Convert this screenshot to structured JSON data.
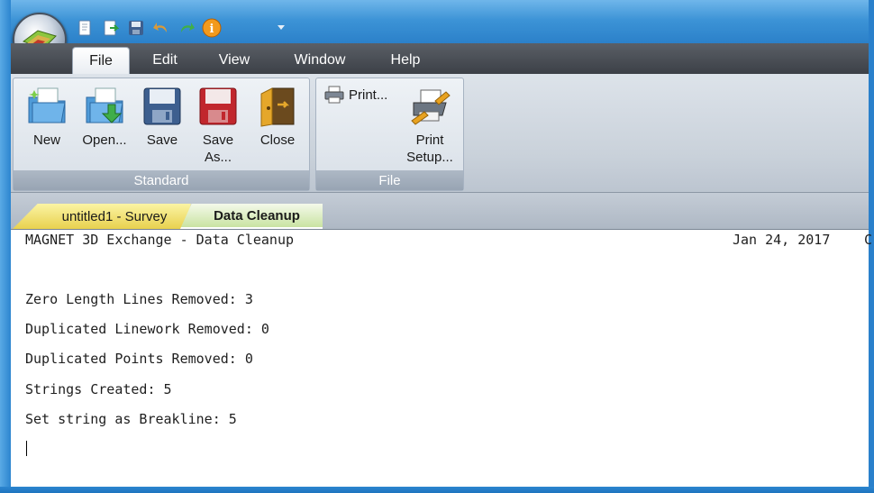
{
  "quick_access": {
    "icons": [
      "new-doc-icon",
      "open-doc-icon",
      "save-icon",
      "undo-icon",
      "redo-icon",
      "info-icon"
    ]
  },
  "menu": {
    "tabs": [
      {
        "label": "File",
        "active": true
      },
      {
        "label": "Edit",
        "active": false
      },
      {
        "label": "View",
        "active": false
      },
      {
        "label": "Window",
        "active": false
      },
      {
        "label": "Help",
        "active": false
      }
    ]
  },
  "ribbon": {
    "groups": {
      "standard": {
        "label": "Standard",
        "buttons": {
          "new": "New",
          "open": "Open...",
          "save": "Save",
          "save_as_line1": "Save",
          "save_as_line2": "As...",
          "close": "Close"
        }
      },
      "file": {
        "label": "File",
        "print": "Print...",
        "print_setup_line1": "Print",
        "print_setup_line2": "Setup..."
      }
    }
  },
  "document_tabs": [
    {
      "label": "untitled1 - Survey",
      "active": false
    },
    {
      "label": "Data Cleanup",
      "active": true
    }
  ],
  "report": {
    "title": "MAGNET 3D Exchange - Data Cleanup",
    "date": "Jan 24, 2017",
    "date_overflow": "C",
    "lines": [
      "Zero Length Lines Removed: 3",
      "Duplicated Linework Removed: 0",
      "Duplicated Points Removed: 0",
      "Strings Created: 5",
      "Set string as Breakline: 5"
    ]
  },
  "colors": {
    "window_frame": "#1e88d2",
    "tab_strip": "#4a4f56",
    "ribbon": "#d3dae2",
    "survey_tab": "#f0df6a",
    "cleanup_tab": "#dcedc4"
  }
}
